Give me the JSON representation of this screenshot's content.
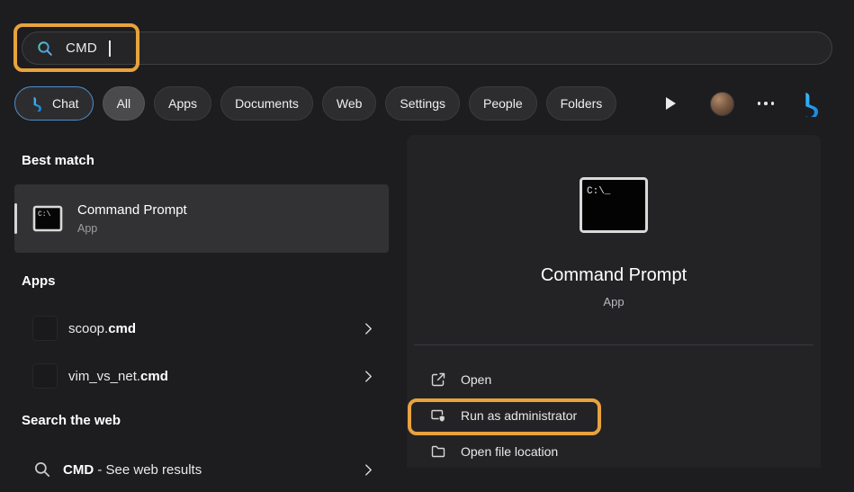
{
  "search": {
    "value": "CMD",
    "icon": "search-icon"
  },
  "tabs": [
    {
      "label": "Chat",
      "selected": false,
      "icon": "bing-chat-icon"
    },
    {
      "label": "All",
      "selected": true
    },
    {
      "label": "Apps",
      "selected": false
    },
    {
      "label": "Documents",
      "selected": false
    },
    {
      "label": "Web",
      "selected": false
    },
    {
      "label": "Settings",
      "selected": false
    },
    {
      "label": "People",
      "selected": false
    },
    {
      "label": "Folders",
      "selected": false
    }
  ],
  "toolbar_icons": [
    "play-icon",
    "user-avatar",
    "more-options-icon",
    "bing-logo-icon"
  ],
  "sections": {
    "best_match_heading": "Best match",
    "apps_heading": "Apps",
    "web_heading": "Search the web"
  },
  "best_match": {
    "title": "Command Prompt",
    "subtitle": "App",
    "icon": "command-prompt-icon"
  },
  "apps": [
    {
      "prefix": "scoop.",
      "match": "cmd"
    },
    {
      "prefix": "vim_vs_net.",
      "match": "cmd"
    }
  ],
  "web_results": {
    "match": "CMD",
    "rest": " - See web results",
    "icon": "search-icon"
  },
  "preview": {
    "title": "Command Prompt",
    "subtitle": "App",
    "icon": "command-prompt-icon",
    "actions": [
      {
        "label": "Open",
        "icon": "open-icon"
      },
      {
        "label": "Run as administrator",
        "icon": "admin-shield-icon",
        "highlighted": true
      },
      {
        "label": "Open file location",
        "icon": "folder-icon"
      }
    ]
  },
  "annotations": {
    "color": "#E8A33D",
    "boxes": [
      "search-input",
      "run-as-administrator"
    ]
  },
  "colors": {
    "background": "#1d1d1f",
    "panel": "#232326",
    "selected_pill": "#4A4A4D",
    "chat_border": "#4E8FD0",
    "highlight": "#E8A33D"
  }
}
